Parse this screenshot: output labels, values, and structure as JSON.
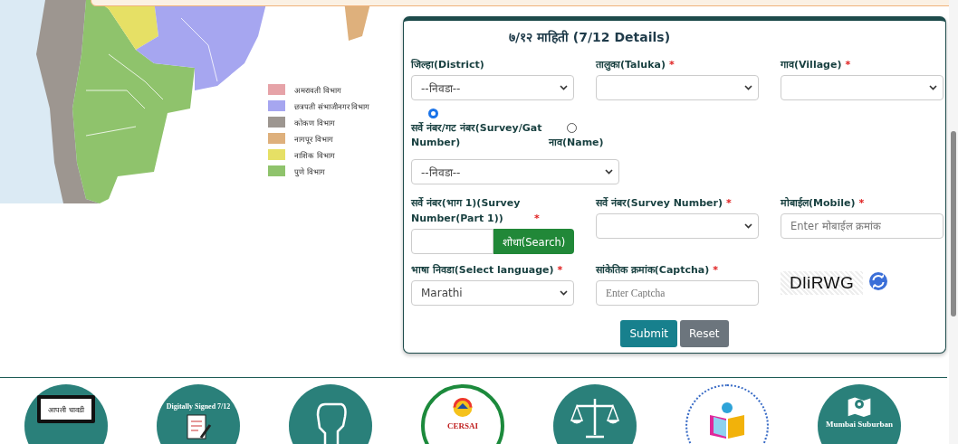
{
  "map": {
    "legend": [
      {
        "label": "अमरावती विभाग",
        "color": "#e6a3a8"
      },
      {
        "label": "छत्रपती संभाजीनगर विभाग",
        "color": "#a6a6f0"
      },
      {
        "label": "कोकण विभाग",
        "color": "#9d9690"
      },
      {
        "label": "नागपूर विभाग",
        "color": "#deb07c"
      },
      {
        "label": "नाशिक विभाग",
        "color": "#e6e065"
      },
      {
        "label": "पुणे विभाग",
        "color": "#8fc36c"
      }
    ]
  },
  "form": {
    "title": "७/१२ माहिती (7/12 Details)",
    "row_1": [
      {
        "kind": "select",
        "label": "जिल्हा(District)",
        "value": "--निवडा--"
      },
      {
        "kind": "select",
        "label": "तालुका(Taluka)",
        "required_mark": "*"
      },
      {
        "kind": "select",
        "label": "गाव(Village)",
        "required_mark": "*"
      }
    ],
    "search_by": {
      "options": [
        {
          "label": "सर्वे नंबर/गट नंबर(Survey/Gat Number)",
          "selected": true
        },
        {
          "label": "नाव(Name)",
          "selected": false
        }
      ],
      "value": "--निवडा--"
    },
    "row_3": [
      {
        "kind": "search",
        "label": "सर्वे नंबर(भाग 1)(Survey Number(Part 1))",
        "required_mark": "*",
        "button": "शोधा(Search)"
      },
      {
        "kind": "select",
        "label": "सर्वे नंबर(Survey Number)",
        "required_mark": "*"
      },
      {
        "kind": "text",
        "label": "मोबाईल(Mobile)",
        "required_mark": "*",
        "placeholder": "Enter मोबाईल क्रमांक"
      }
    ],
    "row_4": [
      {
        "kind": "select",
        "label": "भाषा निवडा(Select language)",
        "required_mark": "*",
        "value": "Marathi"
      },
      {
        "kind": "text",
        "label": "सांकेतिक क्रमांक(Captcha)",
        "required_mark": "*",
        "placeholder": "Enter Captcha"
      },
      {
        "kind": "captcha",
        "text": "DliRWG"
      }
    ],
    "buttons": [
      {
        "label": "Submit",
        "kind": "primary"
      },
      {
        "label": "Reset",
        "kind": "secondary"
      }
    ]
  },
  "services": [
    {
      "kind": "monitor",
      "label": "आपली चावडी"
    },
    {
      "kind": "signed",
      "label": "Digitally Signed 7/12"
    },
    {
      "kind": "fist"
    },
    {
      "kind": "cersai",
      "label": "CERSAI"
    },
    {
      "kind": "scales"
    },
    {
      "kind": "books"
    },
    {
      "kind": "pin",
      "label": "Mumbai Suburban"
    }
  ]
}
